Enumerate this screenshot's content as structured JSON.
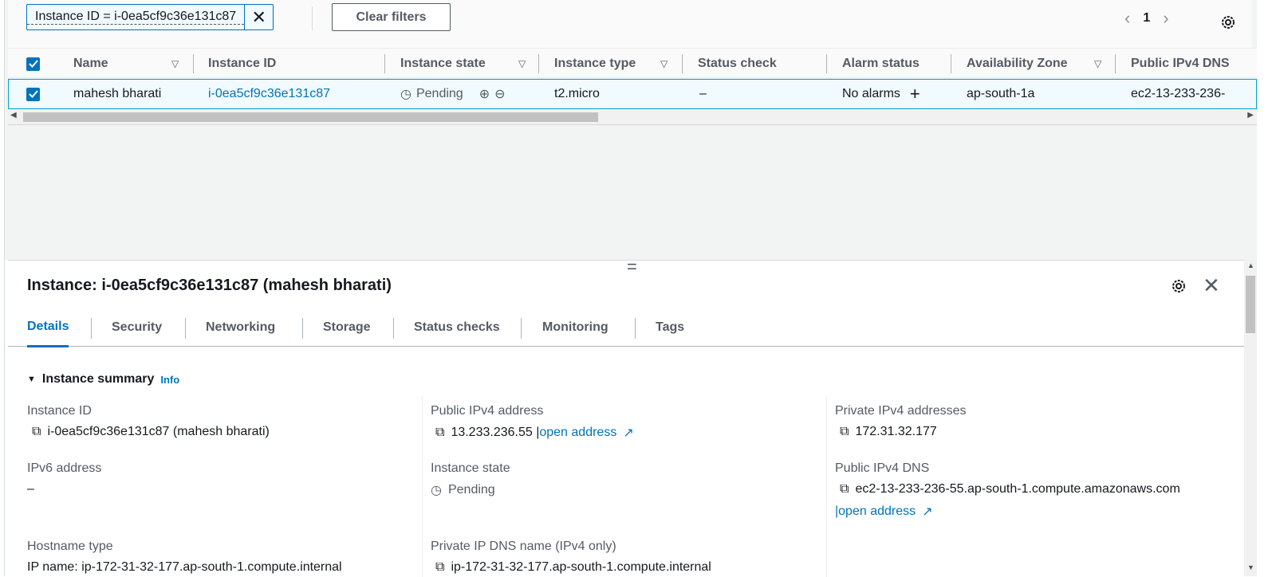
{
  "filter": {
    "token": "Instance ID = i-0ea5cf9c36e131c87",
    "clear_label": "Clear filters"
  },
  "pager": {
    "page": "1"
  },
  "table": {
    "headers": [
      "Name",
      "Instance ID",
      "Instance state",
      "Instance type",
      "Status check",
      "Alarm status",
      "Availability Zone",
      "Public IPv4 DNS"
    ],
    "row": {
      "name": "mahesh bharati",
      "id": "i-0ea5cf9c36e131c87",
      "state": "Pending",
      "type": "t2.micro",
      "status_check": "–",
      "alarm": "No alarms",
      "az": "ap-south-1a",
      "dns": "ec2-13-233-236-"
    }
  },
  "panel": {
    "title": "Instance: i-0ea5cf9c36e131c87 (mahesh bharati)",
    "tabs": [
      "Details",
      "Security",
      "Networking",
      "Storage",
      "Status checks",
      "Monitoring",
      "Tags"
    ],
    "section": "Instance summary",
    "info": "Info",
    "fields": {
      "instance_id_label": "Instance ID",
      "instance_id": "i-0ea5cf9c36e131c87 (mahesh bharati)",
      "public_ip_label": "Public IPv4 address",
      "public_ip": "13.233.236.55 |",
      "open_address": "open address",
      "private_ip_label": "Private IPv4 addresses",
      "private_ip": "172.31.32.177",
      "ipv6_label": "IPv6 address",
      "ipv6": "–",
      "state_label": "Instance state",
      "state": "Pending",
      "public_dns_label": "Public IPv4 DNS",
      "public_dns": "ec2-13-233-236-55.ap-south-1.compute.amazonaws.com",
      "open_address2": "|open address",
      "hostname_label": "Hostname type",
      "hostname": "IP name: ip-172-31-32-177.ap-south-1.compute.internal",
      "private_dns_label": "Private IP DNS name (IPv4 only)",
      "private_dns": "ip-172-31-32-177.ap-south-1.compute.internal"
    }
  },
  "colors": {
    "accent": "#0073bb",
    "selected_bg": "#f1faff"
  }
}
